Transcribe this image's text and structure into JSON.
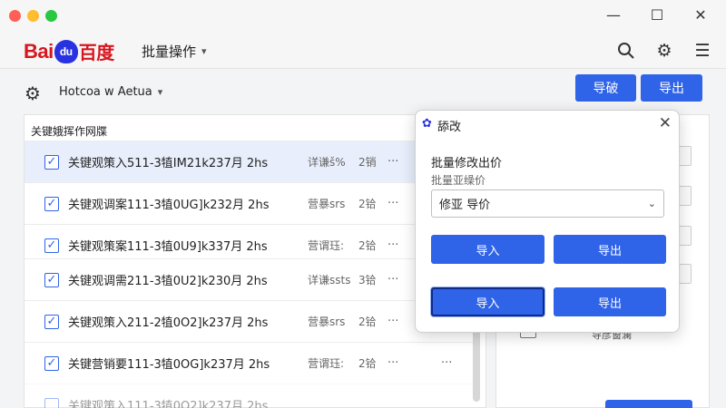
{
  "window": {
    "controls": {
      "minimize": "—",
      "maximize": "☐",
      "close": "✕"
    }
  },
  "app": {
    "logo": {
      "bai": "Bai",
      "du": "du",
      "cn": "百度"
    },
    "name": "批量操作"
  },
  "account": {
    "name": "Hotcoa w Aetua"
  },
  "toolbar": {
    "import_label": "导破",
    "export_label": "导出"
  },
  "panel": {
    "tab_label": "关键娥挥作网牒",
    "rows": [
      {
        "name": "关键观策入511-3犆IM21k237月 2hs",
        "tag": "详谦š%",
        "stat": "2销",
        "more": "···",
        "checked": true,
        "selected": true
      },
      {
        "name": "关键观调案111-3犆0UG]k232月 2hs",
        "tag": "营暴srs",
        "stat": "2铪",
        "more": "···",
        "checked": true,
        "selected": false
      },
      {
        "name": "关键观策案111-3犆0U9]k337月 2hs",
        "tag": "营谓珏:",
        "stat": "2铪",
        "more": "···",
        "checked": true,
        "selected": false
      },
      {
        "name": "关键观调需211-3犆0U2]k230月 2hs",
        "tag": "详谦ssts",
        "stat": "3铪",
        "more": "···",
        "checked": true,
        "selected": false
      },
      {
        "name": "关键观策入211-2犆0O2]k237月 2hs",
        "tag": "营暴srs",
        "stat": "2铪",
        "more": "···",
        "checked": true,
        "selected": false
      },
      {
        "name": "关键营销要111-3犆0OG]k237月 2hs",
        "tag": "营谓珏:",
        "stat": "2铪",
        "more": "···",
        "checked": true,
        "selected": false
      },
      {
        "name": "关键观策入111-3犆0O2]k237月 2hs",
        "tag": "",
        "stat": "",
        "more": "",
        "checked": false,
        "selected": false
      }
    ]
  },
  "right_panel": {
    "label": "导彦窗澜"
  },
  "dialog": {
    "title": "舔改",
    "heading": "批量修改出价",
    "sublabel": "批量亚缲价",
    "select_value": "修亚 导价",
    "btn_import_1": "导入",
    "btn_export_1": "导出",
    "btn_import_2": "导入",
    "btn_export_2": "导出"
  },
  "colors": {
    "accent": "#2f63e8",
    "brand_red": "#d6161f",
    "brand_blue": "#2932e1"
  }
}
